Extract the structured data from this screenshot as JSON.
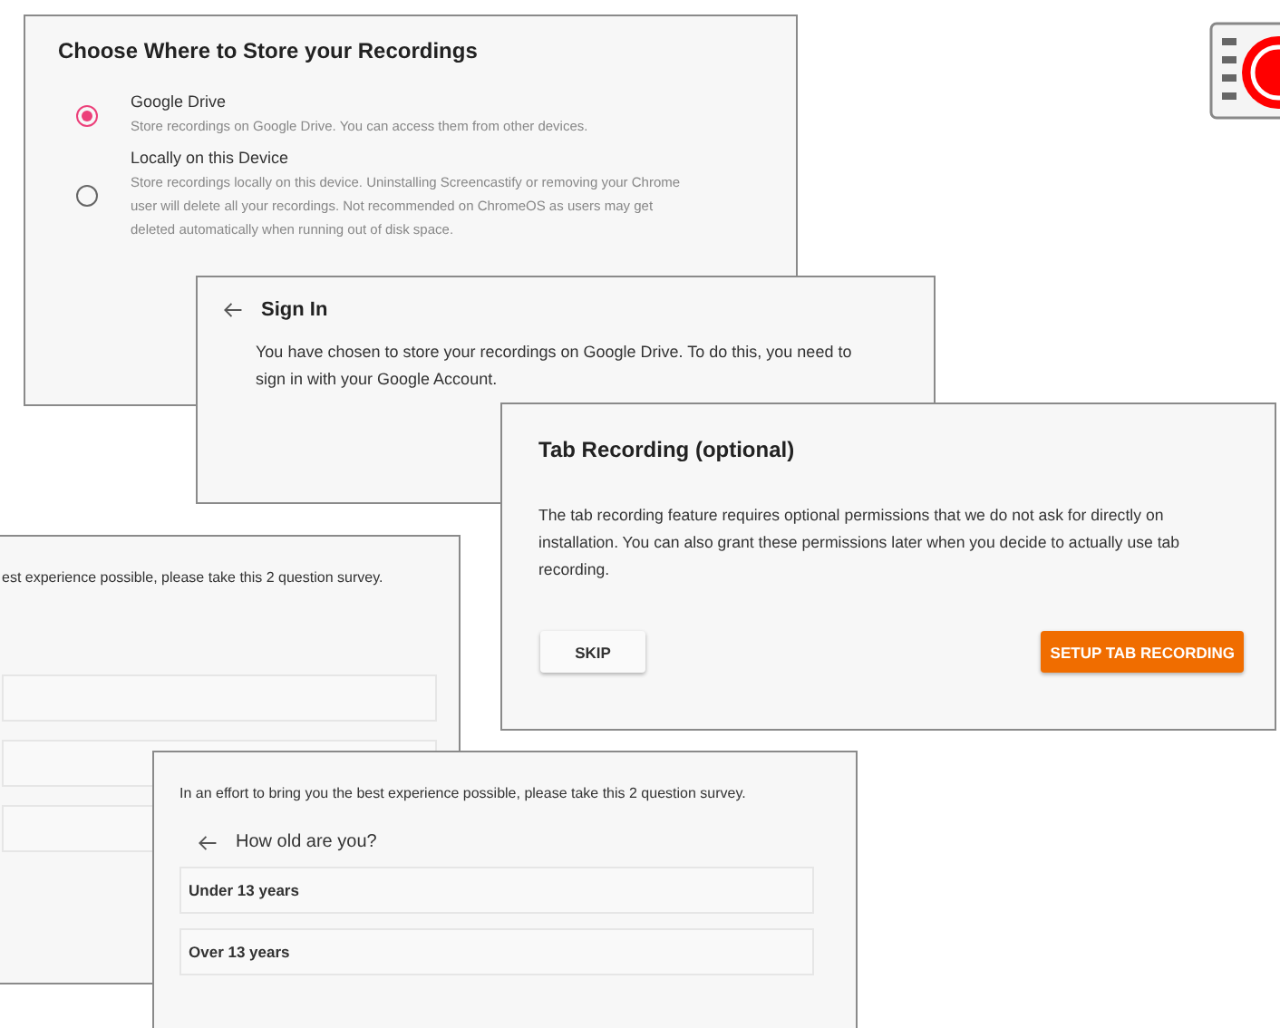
{
  "storage_dialog": {
    "title": "Choose Where to Store your Recordings",
    "options": [
      {
        "label": "Google Drive",
        "description": "Store recordings on Google Drive. You can access them from other devices.",
        "selected": true
      },
      {
        "label": "Locally on this Device",
        "description": "Store recordings locally on this device. Uninstalling Screencastify or removing your Chrome user will delete all your recordings. Not recommended on ChromeOS as users may get deleted automatically when running out of disk space.",
        "selected": false
      }
    ]
  },
  "sign_in_dialog": {
    "title": "Sign In",
    "message": "You have chosen to store your recordings on Google Drive. To do this, you need to sign in with your Google Account."
  },
  "tab_recording_dialog": {
    "title": "Tab Recording (optional)",
    "message": "The tab recording feature requires optional permissions that we do not ask for directly on installation. You can also grant these permissions later when you decide to actually use tab recording.",
    "buttons": [
      {
        "label": "SKIP",
        "kind": "secondary"
      },
      {
        "label": "SETUP TAB RECORDING",
        "kind": "primary"
      }
    ]
  },
  "survey_back": {
    "intro": "est experience possible, please take this 2 question survey."
  },
  "survey_front": {
    "intro": "In an effort to bring you the best experience possible, please take this 2 question survey.",
    "question": "How old are you?",
    "answers": [
      "Under 13 years",
      "Over 13 years"
    ]
  }
}
